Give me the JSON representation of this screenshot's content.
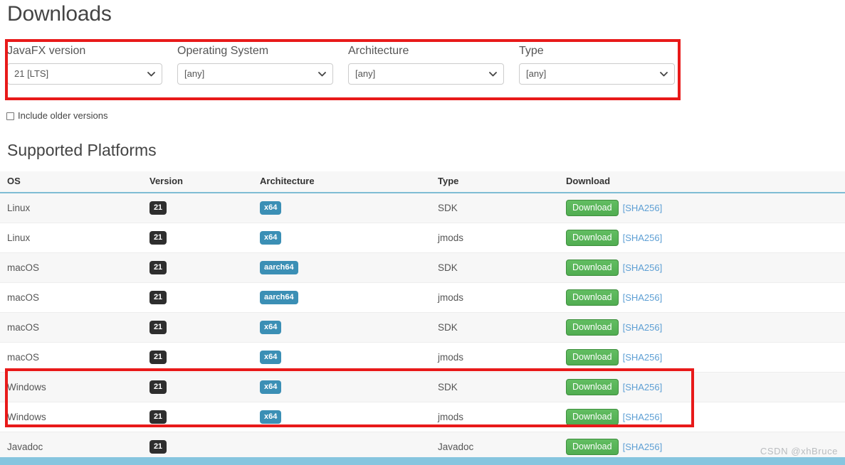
{
  "page": {
    "title": "Downloads",
    "section_title": "Supported Platforms",
    "watermark": "CSDN @xhBruce"
  },
  "filters": {
    "javafx_version": {
      "label": "JavaFX version",
      "value": "21 [LTS]"
    },
    "operating_system": {
      "label": "Operating System",
      "value": "[any]"
    },
    "architecture": {
      "label": "Architecture",
      "value": "[any]"
    },
    "type": {
      "label": "Type",
      "value": "[any]"
    },
    "include_older": {
      "label": "Include older versions",
      "checked": false
    }
  },
  "table": {
    "columns": [
      "OS",
      "Version",
      "Architecture",
      "Type",
      "Download"
    ],
    "rows": [
      {
        "os": "Linux",
        "version": "21",
        "arch": "x64",
        "type": "SDK",
        "download": "Download",
        "sha": "[SHA256]"
      },
      {
        "os": "Linux",
        "version": "21",
        "arch": "x64",
        "type": "jmods",
        "download": "Download",
        "sha": "[SHA256]"
      },
      {
        "os": "macOS",
        "version": "21",
        "arch": "aarch64",
        "type": "SDK",
        "download": "Download",
        "sha": "[SHA256]"
      },
      {
        "os": "macOS",
        "version": "21",
        "arch": "aarch64",
        "type": "jmods",
        "download": "Download",
        "sha": "[SHA256]"
      },
      {
        "os": "macOS",
        "version": "21",
        "arch": "x64",
        "type": "SDK",
        "download": "Download",
        "sha": "[SHA256]"
      },
      {
        "os": "macOS",
        "version": "21",
        "arch": "x64",
        "type": "jmods",
        "download": "Download",
        "sha": "[SHA256]"
      },
      {
        "os": "Windows",
        "version": "21",
        "arch": "x64",
        "type": "SDK",
        "download": "Download",
        "sha": "[SHA256]"
      },
      {
        "os": "Windows",
        "version": "21",
        "arch": "x64",
        "type": "jmods",
        "download": "Download",
        "sha": "[SHA256]"
      },
      {
        "os": "Javadoc",
        "version": "21",
        "arch": "",
        "type": "Javadoc",
        "download": "Download",
        "sha": "[SHA256]"
      }
    ]
  },
  "colors": {
    "highlight_box": "#e81a1a",
    "version_badge": "#2e2e2e",
    "arch_badge": "#3b8fb5",
    "download_button": "#57b257",
    "sha_link": "#5d9fd4",
    "header_underline": "#7fbdd4",
    "bottom_bar": "#86c5df"
  }
}
